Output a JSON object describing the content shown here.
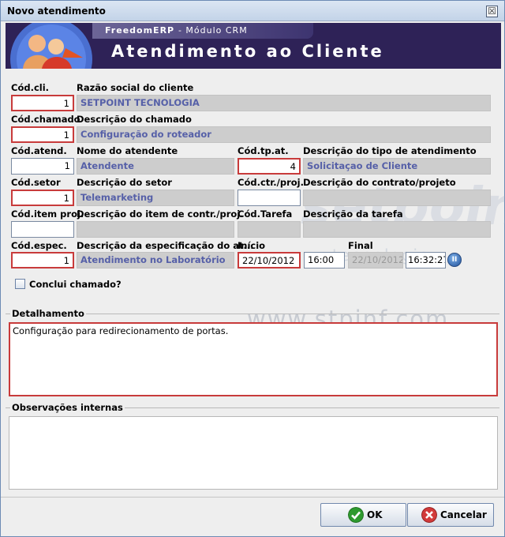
{
  "window": {
    "title": "Novo atendimento",
    "close_glyph": "☒"
  },
  "banner": {
    "product": "FreedomERP",
    "module": "- Módulo CRM",
    "heading": "Atendimento ao Cliente"
  },
  "watermarks": {
    "brand": "setpoint",
    "brand_sub": "tecnologia",
    "url1": "www.stpinf.com",
    "url2": "www.freedom.org.br"
  },
  "form": {
    "cod_cli": {
      "label": "Cód.cli.",
      "value": "1"
    },
    "razao": {
      "label": "Razão social do cliente",
      "value": "SETPOINT TECNOLOGIA"
    },
    "cod_chamado": {
      "label": "Cód.chamado",
      "value": "1"
    },
    "desc_chamado": {
      "label": "Descrição do chamado",
      "value": "Configuração do roteador"
    },
    "cod_atend": {
      "label": "Cód.atend.",
      "value": "1"
    },
    "nome_atend": {
      "label": "Nome do atendente",
      "value": "Atendente"
    },
    "cod_tpat": {
      "label": "Cód.tp.at.",
      "value": "4"
    },
    "desc_tpat": {
      "label": "Descrição do tipo de atendimento",
      "value": "Solicitaçao de Cliente"
    },
    "cod_setor": {
      "label": "Cód.setor",
      "value": "1"
    },
    "desc_setor": {
      "label": "Descrição do setor",
      "value": "Telemarketing"
    },
    "cod_ctr": {
      "label": "Cód.ctr./proj.",
      "value": ""
    },
    "desc_ctr": {
      "label": "Descrição do contrato/projeto",
      "value": ""
    },
    "cod_item": {
      "label": "Cód.item proj.",
      "value": ""
    },
    "desc_item": {
      "label": "Descrição do item de contr./proj.",
      "value": ""
    },
    "cod_tarefa": {
      "label": "Cód.Tarefa",
      "value": ""
    },
    "desc_tarefa": {
      "label": "Descrição da tarefa",
      "value": ""
    },
    "cod_espec": {
      "label": "Cód.espec.",
      "value": "1"
    },
    "desc_espec": {
      "label": "Descrição da especificação do at...",
      "value": "Atendimento no Laboratório"
    },
    "inicio": {
      "label": "Início",
      "date": "22/10/2012",
      "time": "16:00"
    },
    "final": {
      "label": "Final",
      "date": "22/10/2012",
      "time": "16:32:27"
    },
    "conclui": {
      "label": "Conclui chamado?",
      "checked": false
    }
  },
  "detalhamento": {
    "label": "Detalhamento",
    "text": "Configuração para redirecionamento de portas."
  },
  "observacoes": {
    "label": "Observações internas",
    "text": ""
  },
  "buttons": {
    "ok": "OK",
    "cancel": "Cancelar"
  },
  "colors": {
    "required_border": "#c83b3b",
    "readonly_text": "#5660a8",
    "banner_bg": "#2e2257"
  }
}
